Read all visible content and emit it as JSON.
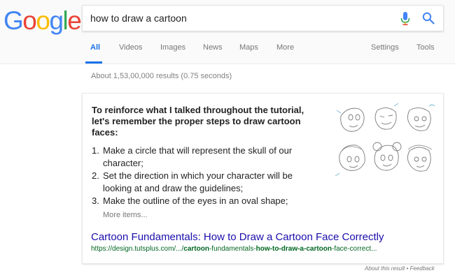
{
  "logo": {
    "letters": [
      "G",
      "o",
      "o",
      "g",
      "l",
      "e"
    ],
    "colors": [
      "#4285f4",
      "#ea4335",
      "#fbbc05",
      "#4285f4",
      "#34a853",
      "#ea4335"
    ]
  },
  "search": {
    "query": "how to draw a cartoon",
    "mic_icon": "mic-icon",
    "search_icon": "search-icon",
    "accent": "#1a73e8"
  },
  "tabs": {
    "all": "All",
    "videos": "Videos",
    "images": "Images",
    "news": "News",
    "maps": "Maps",
    "more": "More",
    "settings": "Settings",
    "tools": "Tools",
    "active": "All"
  },
  "results": {
    "stats": "About 1,53,00,000 results (0.75 seconds)",
    "featured": {
      "heading": "To reinforce what I talked throughout the tutorial, let's remember the proper steps to draw cartoon faces:",
      "steps": [
        {
          "num": "1.",
          "text": "Make a circle that will represent the skull of our character;"
        },
        {
          "num": "2.",
          "text": "Set the direction in which your character will be looking at and draw the guidelines;"
        },
        {
          "num": "3.",
          "text": "Make the outline of the eyes in an oval shape;"
        }
      ],
      "more_items": "More items...",
      "title": "Cartoon Fundamentals: How to Draw a Cartoon Face Correctly",
      "url_prefix": "https://design.tutsplus.com/.../",
      "url_b1": "cartoon",
      "url_mid": "-fundamentals-",
      "url_b2": "how-to-draw-a-cartoon",
      "url_suffix": "-face-correct..."
    },
    "footer_about": "About this result",
    "footer_sep": " • ",
    "footer_feedback": "Feedback"
  }
}
